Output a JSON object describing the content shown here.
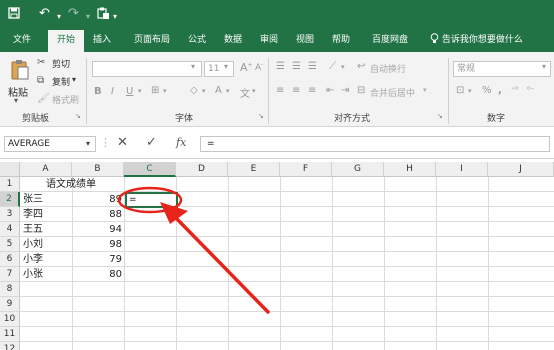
{
  "quick_access": {
    "save_icon": "save-icon",
    "undo_icon": "undo-icon",
    "redo_icon": "redo-icon",
    "touch_icon": "touch-mode-icon"
  },
  "ribbon_tabs": [
    "文件",
    "开始",
    "插入",
    "页面布局",
    "公式",
    "数据",
    "审阅",
    "视图",
    "帮助",
    "百度网盘"
  ],
  "active_tab": "开始",
  "tell_me": "告诉我你想要做什么",
  "clipboard": {
    "paste": "粘贴",
    "cut": "剪切",
    "copy": "复制",
    "format_painter": "格式刷",
    "group_label": "剪贴板"
  },
  "font": {
    "size": "11",
    "group_label": "字体"
  },
  "alignment": {
    "wrap_text": "自动换行",
    "merge_center": "合并后居中",
    "group_label": "对齐方式"
  },
  "number": {
    "format": "常规",
    "group_label": "数字"
  },
  "formula_bar": {
    "name_box": "AVERAGE",
    "cancel_icon": "cancel-icon",
    "enter_icon": "check-icon",
    "fx": "fx",
    "content": "="
  },
  "columns": [
    "A",
    "B",
    "C",
    "D",
    "E",
    "F",
    "G",
    "H",
    "I",
    "J"
  ],
  "rows": [
    "1",
    "2",
    "3",
    "4",
    "5",
    "6",
    "7",
    "8",
    "9",
    "10",
    "11",
    "12"
  ],
  "sheet": {
    "title": "语文成绩单",
    "records": [
      {
        "name": "张三",
        "score": "89"
      },
      {
        "name": "李四",
        "score": "88"
      },
      {
        "name": "王五",
        "score": "94"
      },
      {
        "name": "小刘",
        "score": "98"
      },
      {
        "name": "小李",
        "score": "79"
      },
      {
        "name": "小张",
        "score": "80"
      }
    ],
    "active_cell_value": "="
  },
  "colors": {
    "brand": "#217346",
    "annotation": "#e8231b"
  }
}
